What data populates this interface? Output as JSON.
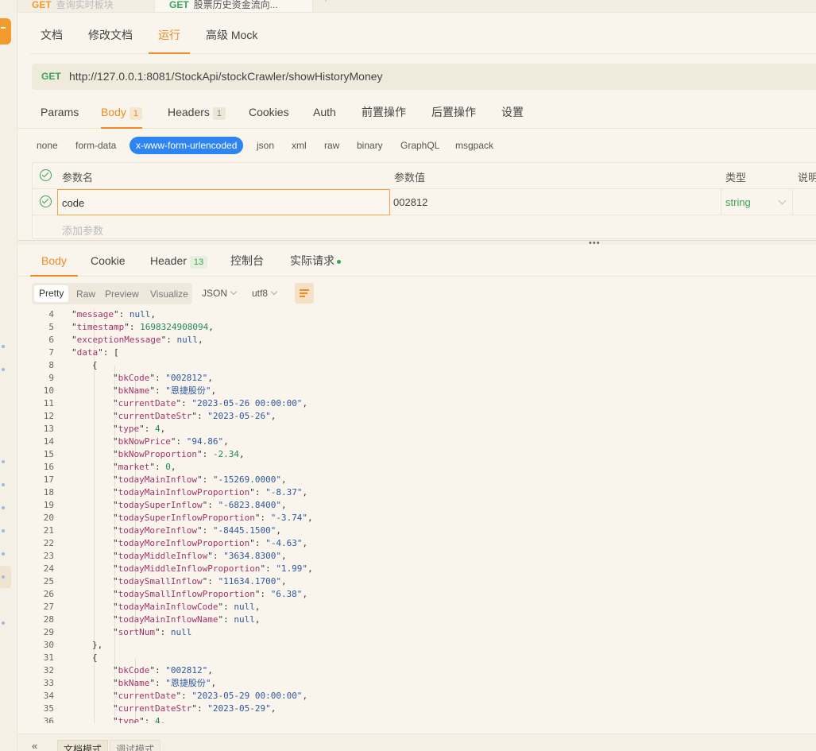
{
  "request_tabs": [
    {
      "method": "GET",
      "title": "查询实时板块"
    },
    {
      "method": "GET",
      "title": "股票历史资金流向..."
    }
  ],
  "tab_add": "+",
  "subnav": {
    "docs": "文档",
    "edit_docs": "修改文档",
    "run": "运行",
    "mock": "高级 Mock"
  },
  "url": {
    "method": "GET",
    "value": "http://127.0.0.1:8081/StockApi/stockCrawler/showHistoryMoney"
  },
  "param_tabs": {
    "params": "Params",
    "body": "Body",
    "body_count": "1",
    "headers": "Headers",
    "headers_count": "1",
    "cookies": "Cookies",
    "auth": "Auth",
    "pre": "前置操作",
    "post": "后置操作",
    "settings": "设置"
  },
  "body_types": [
    "none",
    "form-data",
    "x-www-form-urlencoded",
    "json",
    "xml",
    "raw",
    "binary",
    "GraphQL",
    "msgpack"
  ],
  "param_table": {
    "headers": {
      "name": "参数名",
      "value": "参数值",
      "type": "类型",
      "desc": "说明"
    },
    "row": {
      "name": "code",
      "value": "002812",
      "type": "string"
    },
    "add_placeholder": "添加参数"
  },
  "splitter_handle": "•••",
  "response_tabs": {
    "body": "Body",
    "cookie": "Cookie",
    "header": "Header",
    "header_count": "13",
    "console": "控制台",
    "actual": "实际请求"
  },
  "view_modes": [
    "Pretty",
    "Raw",
    "Preview",
    "Visualize"
  ],
  "format": "JSON",
  "encoding": "utf8",
  "code_lines": [
    {
      "n": "4",
      "i": 1,
      "k": "message",
      "v": "null",
      "t": "nl",
      "c": ","
    },
    {
      "n": "5",
      "i": 1,
      "k": "timestamp",
      "v": "1698324908094",
      "t": "n",
      "c": ","
    },
    {
      "n": "6",
      "i": 1,
      "k": "exceptionMessage",
      "v": "null",
      "t": "nl",
      "c": ","
    },
    {
      "n": "7",
      "i": 1,
      "k": "data",
      "v": "[",
      "t": "p",
      "c": ""
    },
    {
      "n": "8",
      "i": 2,
      "raw": "{"
    },
    {
      "n": "9",
      "i": 3,
      "k": "bkCode",
      "v": "\"002812\"",
      "t": "s",
      "c": ","
    },
    {
      "n": "10",
      "i": 3,
      "k": "bkName",
      "v": "\"恩捷股份\"",
      "t": "s",
      "c": ","
    },
    {
      "n": "11",
      "i": 3,
      "k": "currentDate",
      "v": "\"2023-05-26 00:00:00\"",
      "t": "s",
      "c": ","
    },
    {
      "n": "12",
      "i": 3,
      "k": "currentDateStr",
      "v": "\"2023-05-26\"",
      "t": "s",
      "c": ","
    },
    {
      "n": "13",
      "i": 3,
      "k": "type",
      "v": "4",
      "t": "n",
      "c": ","
    },
    {
      "n": "14",
      "i": 3,
      "k": "bkNowPrice",
      "v": "\"94.86\"",
      "t": "s",
      "c": ","
    },
    {
      "n": "15",
      "i": 3,
      "k": "bkNowProportion",
      "v": "-2.34",
      "t": "n",
      "c": ","
    },
    {
      "n": "16",
      "i": 3,
      "k": "market",
      "v": "0",
      "t": "n",
      "c": ","
    },
    {
      "n": "17",
      "i": 3,
      "k": "todayMainInflow",
      "v": "\"-15269.0000\"",
      "t": "s",
      "c": ","
    },
    {
      "n": "18",
      "i": 3,
      "k": "todayMainInflowProportion",
      "v": "\"-8.37\"",
      "t": "s",
      "c": ","
    },
    {
      "n": "19",
      "i": 3,
      "k": "todaySuperInflow",
      "v": "\"-6823.8400\"",
      "t": "s",
      "c": ","
    },
    {
      "n": "20",
      "i": 3,
      "k": "todaySuperInflowProportion",
      "v": "\"-3.74\"",
      "t": "s",
      "c": ","
    },
    {
      "n": "21",
      "i": 3,
      "k": "todayMoreInflow",
      "v": "\"-8445.1500\"",
      "t": "s",
      "c": ","
    },
    {
      "n": "22",
      "i": 3,
      "k": "todayMoreInflowProportion",
      "v": "\"-4.63\"",
      "t": "s",
      "c": ","
    },
    {
      "n": "23",
      "i": 3,
      "k": "todayMiddleInflow",
      "v": "\"3634.8300\"",
      "t": "s",
      "c": ","
    },
    {
      "n": "24",
      "i": 3,
      "k": "todayMiddleInflowProportion",
      "v": "\"1.99\"",
      "t": "s",
      "c": ","
    },
    {
      "n": "25",
      "i": 3,
      "k": "todaySmallInflow",
      "v": "\"11634.1700\"",
      "t": "s",
      "c": ","
    },
    {
      "n": "26",
      "i": 3,
      "k": "todaySmallInflowProportion",
      "v": "\"6.38\"",
      "t": "s",
      "c": ","
    },
    {
      "n": "27",
      "i": 3,
      "k": "todayMainInflowCode",
      "v": "null",
      "t": "nl",
      "c": ","
    },
    {
      "n": "28",
      "i": 3,
      "k": "todayMainInflowName",
      "v": "null",
      "t": "nl",
      "c": ","
    },
    {
      "n": "29",
      "i": 3,
      "k": "sortNum",
      "v": "null",
      "t": "nl",
      "c": ""
    },
    {
      "n": "30",
      "i": 2,
      "raw": "},"
    },
    {
      "n": "31",
      "i": 2,
      "raw": "{"
    },
    {
      "n": "32",
      "i": 3,
      "k": "bkCode",
      "v": "\"002812\"",
      "t": "s",
      "c": ","
    },
    {
      "n": "33",
      "i": 3,
      "k": "bkName",
      "v": "\"恩捷股份\"",
      "t": "s",
      "c": ","
    },
    {
      "n": "34",
      "i": 3,
      "k": "currentDate",
      "v": "\"2023-05-29 00:00:00\"",
      "t": "s",
      "c": ","
    },
    {
      "n": "35",
      "i": 3,
      "k": "currentDateStr",
      "v": "\"2023-05-29\"",
      "t": "s",
      "c": ","
    },
    {
      "n": "36",
      "i": 3,
      "k": "type",
      "v": "4",
      "t": "n",
      "c": ","
    }
  ],
  "bottom": {
    "collapse": "«",
    "doc_mode": "文档模式",
    "debug_mode": "调试模式"
  },
  "colors": {
    "accent": "#f08a24",
    "get": "#3aa355",
    "selected_chip": "#2d84f2"
  }
}
